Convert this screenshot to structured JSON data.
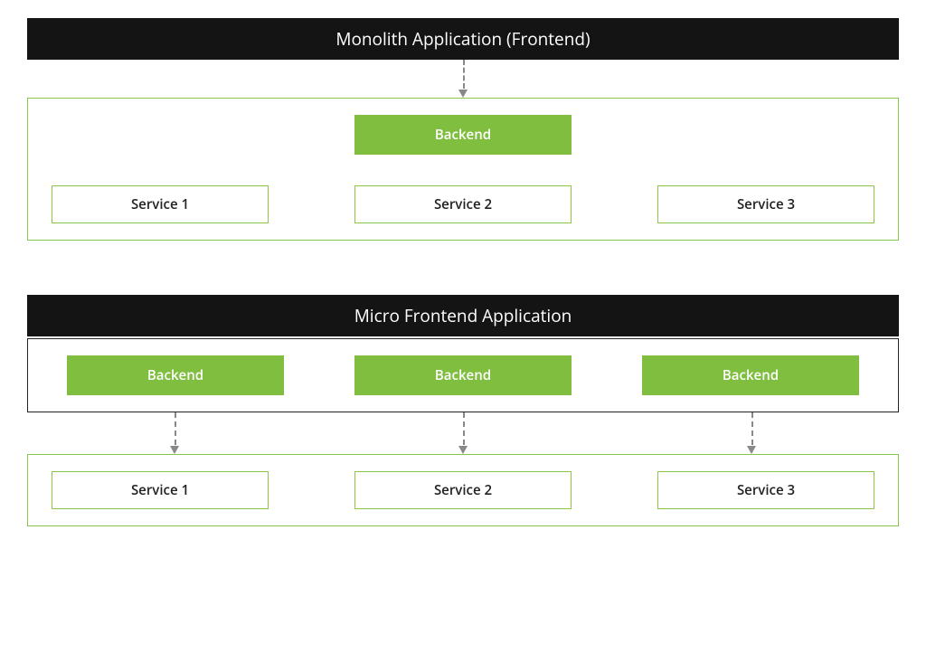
{
  "monolith": {
    "title": "Monolith Application (Frontend)",
    "backend_label": "Backend",
    "services": [
      "Service 1",
      "Service 2",
      "Service 3"
    ]
  },
  "micro": {
    "title": "Micro Frontend Application",
    "backends": [
      "Backend",
      "Backend",
      "Backend"
    ],
    "services": [
      "Service 1",
      "Service 2",
      "Service 3"
    ]
  },
  "colors": {
    "header_bg": "#141414",
    "accent_green": "#7fbe3f",
    "border_green": "#89c64b",
    "arrow_gray": "#888"
  }
}
